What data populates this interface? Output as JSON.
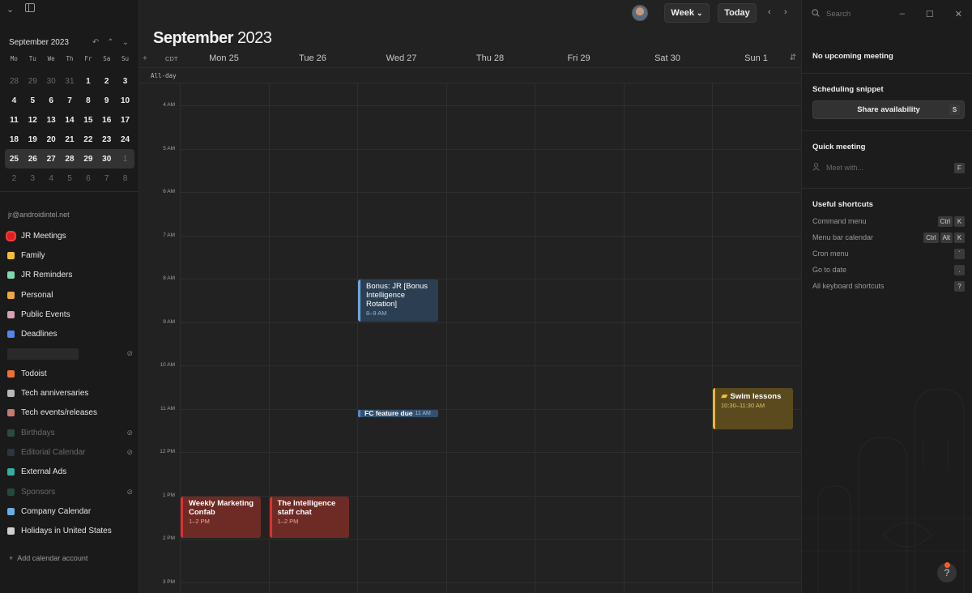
{
  "sidebar": {
    "mini_calendar": {
      "title": "September 2023",
      "weekdays": [
        "Mo",
        "Tu",
        "We",
        "Th",
        "Fr",
        "Sa",
        "Su"
      ],
      "weeks": [
        [
          "28",
          "29",
          "30",
          "31",
          "1",
          "2",
          "3"
        ],
        [
          "4",
          "5",
          "6",
          "7",
          "8",
          "9",
          "10"
        ],
        [
          "11",
          "12",
          "13",
          "14",
          "15",
          "16",
          "17"
        ],
        [
          "18",
          "19",
          "20",
          "21",
          "22",
          "23",
          "24"
        ],
        [
          "25",
          "26",
          "27",
          "28",
          "29",
          "30",
          "1"
        ],
        [
          "2",
          "3",
          "4",
          "5",
          "6",
          "7",
          "8"
        ]
      ]
    },
    "account": "jr@androidintel.net",
    "calendars": [
      {
        "label": "JR Meetings",
        "color": "#e02020",
        "selected": true,
        "hidden": false
      },
      {
        "label": "Family",
        "color": "#f2c032",
        "hidden": false
      },
      {
        "label": "JR Reminders",
        "color": "#7ed9b0",
        "hidden": false
      },
      {
        "label": "Personal",
        "color": "#f2a640",
        "hidden": false
      },
      {
        "label": "Public Events",
        "color": "#d9a0b0",
        "hidden": false
      },
      {
        "label": "Deadlines",
        "color": "#4f86f0",
        "hidden": false
      },
      {
        "label": "",
        "color": "",
        "hidden": true,
        "blurred": true
      },
      {
        "label": "Todoist",
        "color": "#f07030",
        "hidden": false
      },
      {
        "label": "Tech anniversaries",
        "color": "#b8b8b8",
        "hidden": false
      },
      {
        "label": "Tech events/releases",
        "color": "#c87a6a",
        "hidden": false
      },
      {
        "label": "Birthdays",
        "color": "#3a6a5a",
        "hidden": true
      },
      {
        "label": "Editorial Calendar",
        "color": "#3a4a5a",
        "hidden": true
      },
      {
        "label": "External Ads",
        "color": "#30b0a0",
        "hidden": false
      },
      {
        "label": "Sponsors",
        "color": "#2a6a5a",
        "hidden": true
      },
      {
        "label": "Company Calendar",
        "color": "#6aaee8",
        "hidden": false
      },
      {
        "label": "Holidays in United States",
        "color": "#d0d0d0",
        "hidden": false
      }
    ],
    "add_account": "Add calendar account"
  },
  "main": {
    "title_month": "September",
    "title_year": "2023",
    "view_button": "Week",
    "today_button": "Today",
    "timezone": "CDT",
    "allday_label": "All-day",
    "days": [
      "Mon 25",
      "Tue 26",
      "Wed 27",
      "Thu 28",
      "Fri 29",
      "Sat 30",
      "Sun 1"
    ],
    "times": [
      "4 AM",
      "5 AM",
      "6 AM",
      "7 AM",
      "8 AM",
      "9 AM",
      "10 AM",
      "11 AM",
      "12 PM",
      "1 PM",
      "2 PM",
      "3 PM"
    ],
    "events": [
      {
        "title": "Bonus: JR [Bonus Intelligence Rotation]",
        "time": "8–9 AM",
        "day": 2,
        "start": 8,
        "end": 9,
        "style": "blue"
      },
      {
        "title": "FC feature due",
        "time": "11 AM",
        "day": 2,
        "start": 11,
        "end": 11.2,
        "style": "pill"
      },
      {
        "title": "Swim lessons",
        "time": "10:30–11:30 AM",
        "day": 6,
        "start": 10.5,
        "end": 11.5,
        "style": "gold"
      },
      {
        "title": "Weekly Marketing Confab",
        "time": "1–2 PM",
        "day": 0,
        "start": 13,
        "end": 14,
        "style": "red"
      },
      {
        "title": "The Intelligence staff chat",
        "time": "1–2 PM",
        "day": 1,
        "start": 13,
        "end": 14,
        "style": "red"
      }
    ]
  },
  "right_panel": {
    "search_placeholder": "Search",
    "upcoming": "No upcoming meeting",
    "scheduling_title": "Scheduling snippet",
    "share_label": "Share availability",
    "share_key": "S",
    "quick_title": "Quick meeting",
    "meet_placeholder": "Meet with...",
    "meet_key": "F",
    "shortcuts_title": "Useful shortcuts",
    "shortcuts": [
      {
        "label": "Command menu",
        "keys": [
          "Ctrl",
          "K"
        ]
      },
      {
        "label": "Menu bar calendar",
        "keys": [
          "Ctrl",
          "Alt",
          "K"
        ]
      },
      {
        "label": "Cron menu",
        "keys": [
          "`"
        ]
      },
      {
        "label": "Go to date",
        "keys": [
          "."
        ]
      },
      {
        "label": "All keyboard shortcuts",
        "keys": [
          "?"
        ]
      }
    ],
    "help_label": "?"
  }
}
